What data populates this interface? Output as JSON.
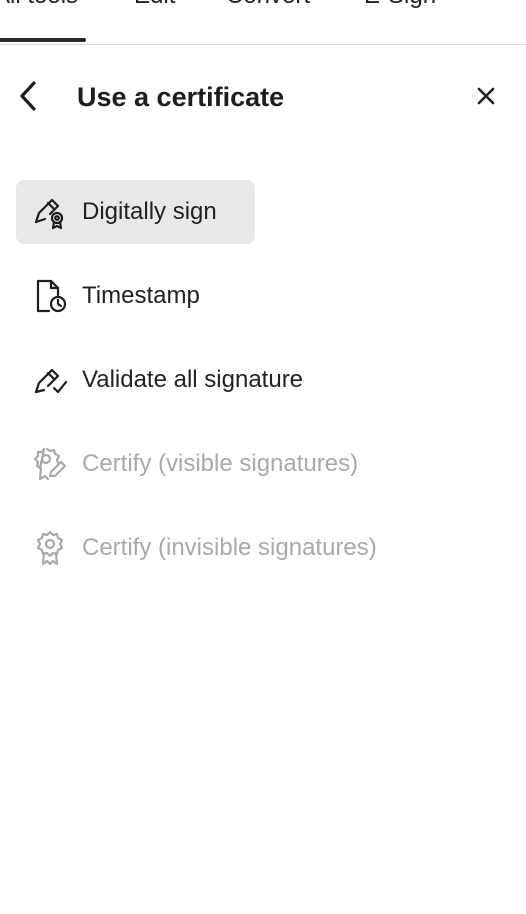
{
  "tabs": [
    {
      "label": "All tools",
      "active": true
    },
    {
      "label": "Edit",
      "active": false
    },
    {
      "label": "Convert",
      "active": false
    },
    {
      "label": "E-Sign",
      "active": false
    }
  ],
  "panel": {
    "title": "Use a certificate",
    "back_icon": "chevron-left-icon",
    "close_icon": "close-icon"
  },
  "menu": [
    {
      "label": "Digitally sign",
      "icon": "digital-sign-icon",
      "selected": true,
      "disabled": false
    },
    {
      "label": "Timestamp",
      "icon": "timestamp-icon",
      "selected": false,
      "disabled": false
    },
    {
      "label": "Validate all signature",
      "icon": "validate-signature-icon",
      "selected": false,
      "disabled": false
    },
    {
      "label": "Certify (visible signatures)",
      "icon": "certify-visible-icon",
      "selected": false,
      "disabled": true
    },
    {
      "label": "Certify (invisible signatures)",
      "icon": "certify-invisible-icon",
      "selected": false,
      "disabled": true
    }
  ],
  "colors": {
    "selected_bg": "#e8e8e8",
    "text": "#1d1d1d",
    "disabled_text": "#a9a9a9",
    "divider": "#d8d8d8"
  }
}
